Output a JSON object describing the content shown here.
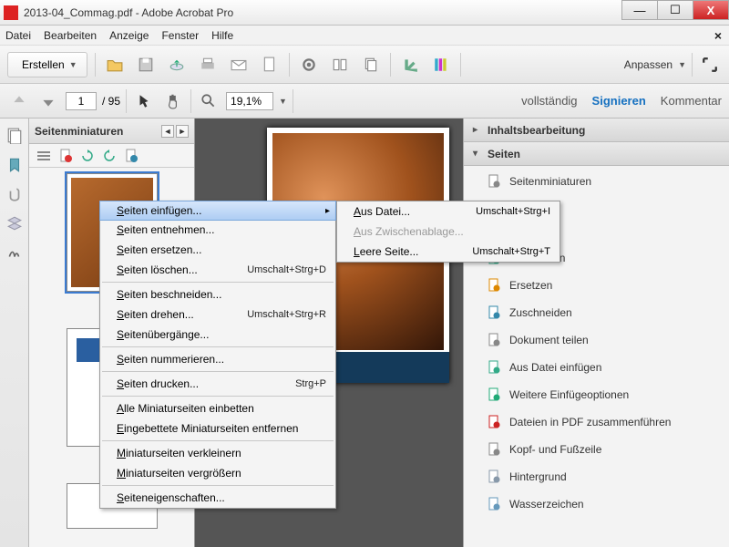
{
  "window": {
    "title": "2013-04_Commag.pdf - Adobe Acrobat Pro"
  },
  "menubar": [
    "Datei",
    "Bearbeiten",
    "Anzeige",
    "Fenster",
    "Hilfe"
  ],
  "toolbar": {
    "create": "Erstellen",
    "customize": "Anpassen"
  },
  "nav": {
    "page_current": "1",
    "page_total": "95",
    "zoom": "19,1%"
  },
  "rightlinks": {
    "full": "vollständig",
    "sign": "Signieren",
    "comment": "Kommentar"
  },
  "thumbs": {
    "title": "Seitenminiaturen"
  },
  "rightpane": {
    "section1": "Inhaltsbearbeitung",
    "section2": "Seiten",
    "items": [
      "Seitenminiaturen",
      "Extrahieren",
      "Ersetzen",
      "Zuschneiden",
      "Dokument teilen",
      "Aus Datei einfügen",
      "Weitere Einfügeoptionen",
      "Dateien in PDF zusammenführen",
      "Kopf- und Fußzeile",
      "Hintergrund",
      "Wasserzeichen"
    ]
  },
  "context": {
    "items": [
      {
        "t": "Seiten einfügen...",
        "sub": true,
        "hl": true
      },
      {
        "t": "Seiten entnehmen..."
      },
      {
        "t": "Seiten ersetzen..."
      },
      {
        "t": "Seiten löschen...",
        "sc": "Umschalt+Strg+D"
      },
      {
        "sep": true
      },
      {
        "t": "Seiten beschneiden..."
      },
      {
        "t": "Seiten drehen...",
        "sc": "Umschalt+Strg+R"
      },
      {
        "t": "Seitenübergänge..."
      },
      {
        "sep": true
      },
      {
        "t": "Seiten nummerieren..."
      },
      {
        "sep": true
      },
      {
        "t": "Seiten drucken...",
        "sc": "Strg+P"
      },
      {
        "sep": true
      },
      {
        "t": "Alle Miniaturseiten einbetten"
      },
      {
        "t": "Eingebettete Miniaturseiten entfernen"
      },
      {
        "sep": true
      },
      {
        "t": "Miniaturseiten verkleinern"
      },
      {
        "t": "Miniaturseiten vergrößern"
      },
      {
        "sep": true
      },
      {
        "t": "Seiteneigenschaften..."
      }
    ],
    "submenu": [
      {
        "t": "Aus Datei...",
        "sc": "Umschalt+Strg+I"
      },
      {
        "t": "Aus Zwischenablage...",
        "disabled": true
      },
      {
        "t": "Leere Seite...",
        "sc": "Umschalt+Strg+T"
      }
    ]
  },
  "icons": {
    "rp": [
      "#888",
      "#3a8",
      "#d80",
      "#38a",
      "#888",
      "#3a8",
      "#2a7",
      "#c22",
      "#888",
      "#89a",
      "#69b"
    ]
  }
}
